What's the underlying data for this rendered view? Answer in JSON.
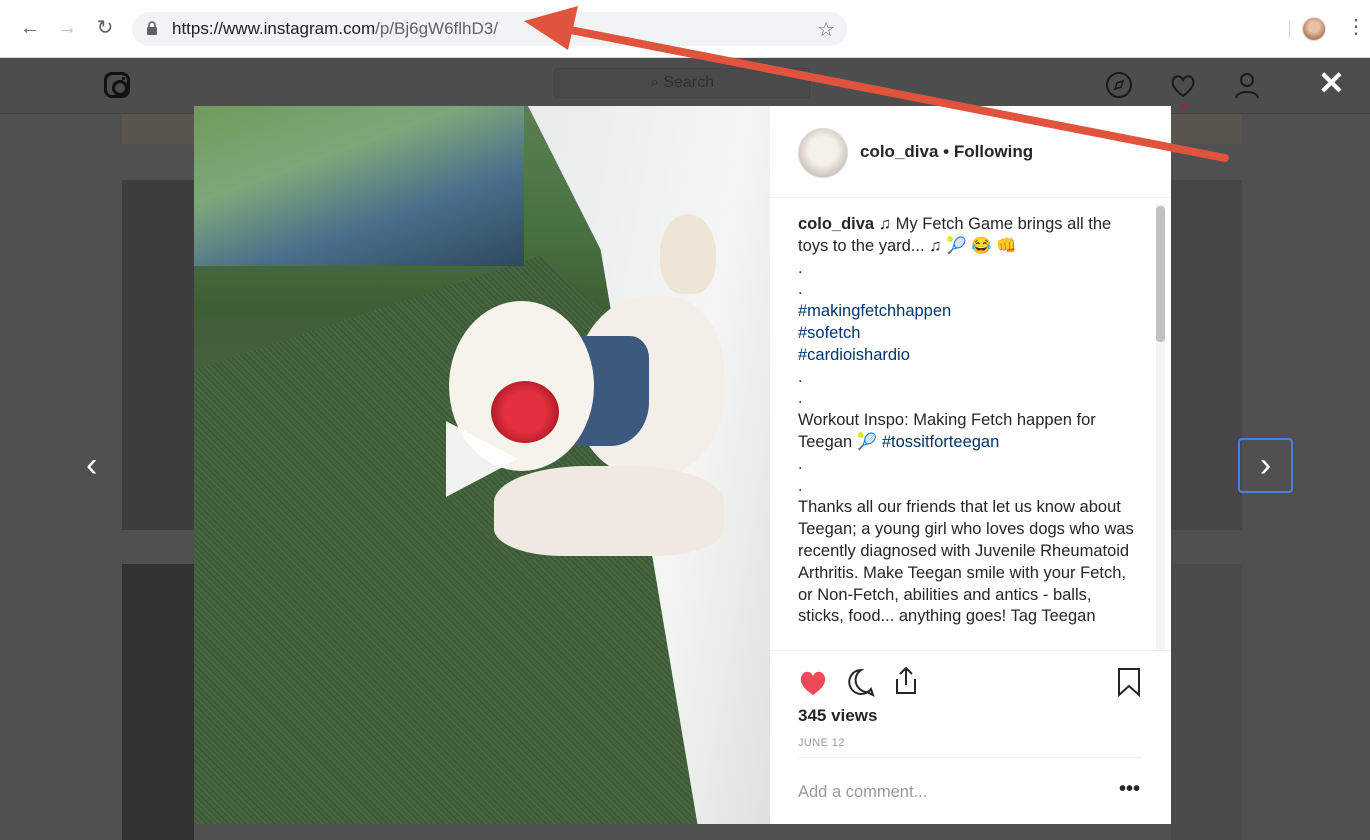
{
  "browser": {
    "back_icon": "arrow-left-icon",
    "forward_icon": "arrow-right-icon",
    "reload_icon": "reload-icon",
    "url_host": "https://www.instagram.com",
    "url_path": "/p/Bj6gW6flhD3/",
    "bookmark_icon": "star-icon",
    "menu_icon": "kebab-menu-icon"
  },
  "instagram_header": {
    "search_placeholder": "⌕ Search",
    "icons": [
      "instagram-logo-icon",
      "compass-icon",
      "heart-icon",
      "profile-icon"
    ]
  },
  "lightbox": {
    "close_label": "✕",
    "prev_label": "‹",
    "next_label": "›"
  },
  "post": {
    "username": "colo_diva",
    "follow_status": "Following",
    "header_text": "colo_diva • Following",
    "caption": {
      "user": "colo_diva",
      "line1": " ♫ My Fetch Game brings all the toys to the yard... ♫ 🎾 😂 👊",
      "dot1": ".",
      "dot2": ".",
      "tag1": "#makingfetchhappen",
      "tag2": "#sofetch",
      "tag3": "#cardioishardio",
      "dot3": ".",
      "dot4": ".",
      "inspo": "Workout Inspo: Making Fetch happen for Teegan 🎾 ",
      "inspo_tag": "#tossitforteegan",
      "dot5": ".",
      "dot6": ".",
      "body": "Thanks all our friends that let us know about Teegan; a young girl who loves dogs who was recently diagnosed with Juvenile Rheumatoid Arthritis. Make Teegan smile with your Fetch, or Non-Fetch, abilities and antics - balls, sticks, food... anything goes! Tag Teegan"
    },
    "views": "345 views",
    "date": "JUNE 12",
    "comment_placeholder": "Add a comment...",
    "more_label": "•••",
    "liked": true
  },
  "colors": {
    "overlay": "#505050",
    "like_red": "#ed4956",
    "hashtag_blue": "#003569",
    "annotation_red": "#e0533d",
    "focus_blue": "#4a80e0"
  }
}
